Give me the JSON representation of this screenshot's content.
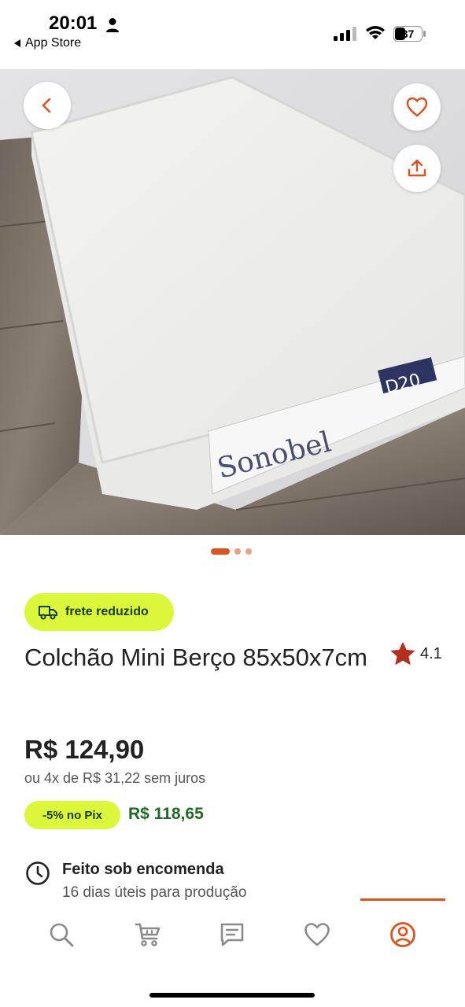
{
  "status_bar": {
    "time": "20:01",
    "back_label": "App Store",
    "battery": "37"
  },
  "product": {
    "image_brand_text": "Sonobel",
    "image_label_text": "D20",
    "carousel_total": 3,
    "carousel_active": 1,
    "shipping_badge": "frete reduzido",
    "title": "Colchão Mini Berço 85x50x7cm",
    "rating": "4.1",
    "price": "R$ 124,90",
    "installments": "ou 4x de R$ 31,22 sem juros",
    "pix_discount": "-5% no Pix",
    "pix_price": "R$ 118,65",
    "made_to_order_title": "Feito sob encomenda",
    "made_to_order_subtitle": "16 dias úteis para produção"
  },
  "bottom_nav": {
    "items": [
      {
        "icon": "search-icon"
      },
      {
        "icon": "cart-icon"
      },
      {
        "icon": "messages-icon"
      },
      {
        "icon": "heart-icon"
      },
      {
        "icon": "account-icon",
        "active": true
      }
    ]
  },
  "colors": {
    "accent": "#e0521c",
    "badge_bg": "#dcf63a",
    "pix_green": "#1d6b25"
  }
}
